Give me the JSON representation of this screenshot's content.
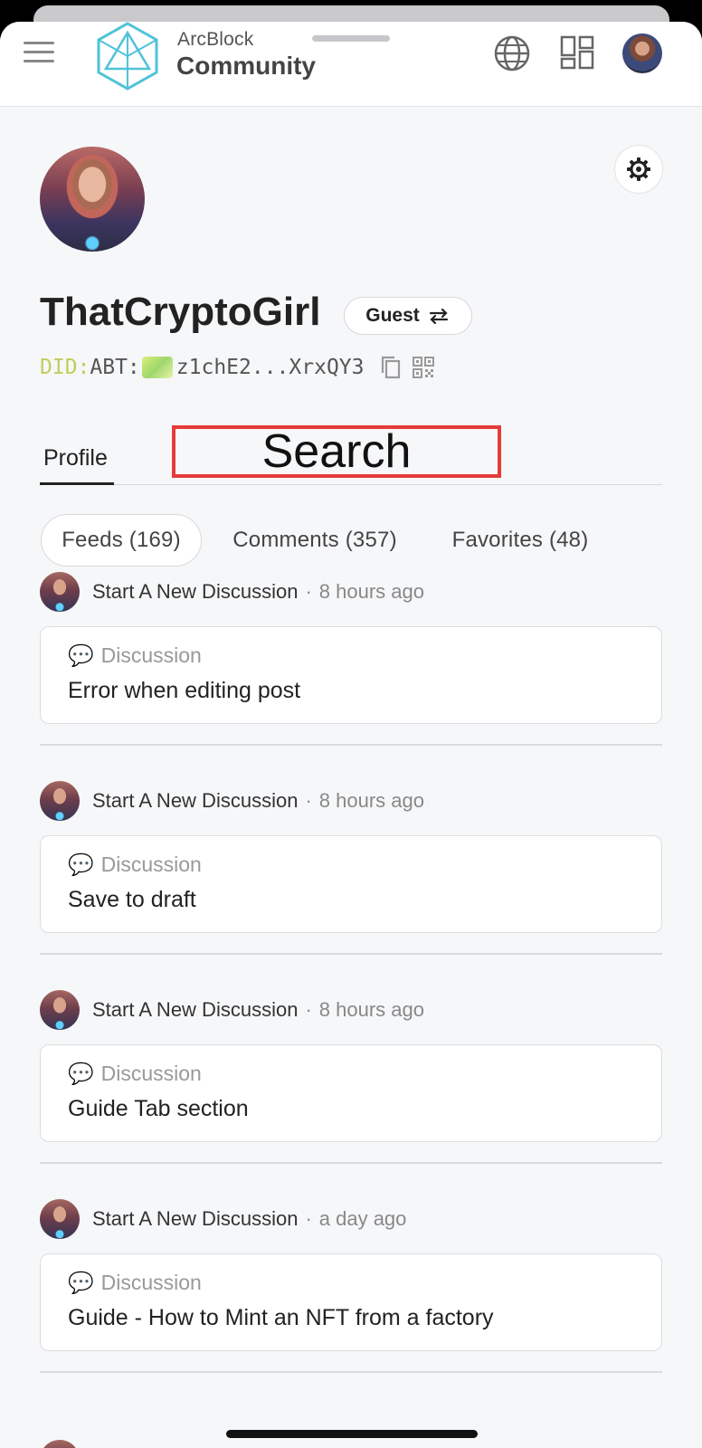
{
  "header": {
    "brand_top": "ArcBlock",
    "brand_bottom": "Community",
    "icons": [
      "menu-icon",
      "arcblock-logo",
      "globe-icon",
      "apps-icon",
      "user-avatar"
    ]
  },
  "profile": {
    "username": "ThatCryptoGirl",
    "role_chip": "Guest",
    "role_chip_icon": "swap-arrows-icon",
    "did_prefix": "DID:",
    "did_type": "ABT:",
    "did_value": "z1chE2...XrxQY3"
  },
  "tabs": {
    "profile": "Profile",
    "search": "Search"
  },
  "subtabs": [
    {
      "label": "Feeds (169)",
      "active": true
    },
    {
      "label": "Comments (357)",
      "active": false
    },
    {
      "label": "Favorites (48)",
      "active": false
    }
  ],
  "feed": [
    {
      "action": "Start A New Discussion",
      "time": "8 hours ago",
      "type": "Discussion",
      "title": "Error when editing post"
    },
    {
      "action": "Start A New Discussion",
      "time": "8 hours ago",
      "type": "Discussion",
      "title": "Save to draft"
    },
    {
      "action": "Start A New Discussion",
      "time": "8 hours ago",
      "type": "Discussion",
      "title": "Guide Tab section"
    },
    {
      "action": "Start A New Discussion",
      "time": "a day ago",
      "type": "Discussion",
      "title": "Guide - How to Mint an NFT from a factory"
    }
  ],
  "colors": {
    "accent_highlight": "#e63a3a",
    "background": "#f6f7f9",
    "did_prefix": "#c3cc5a"
  }
}
